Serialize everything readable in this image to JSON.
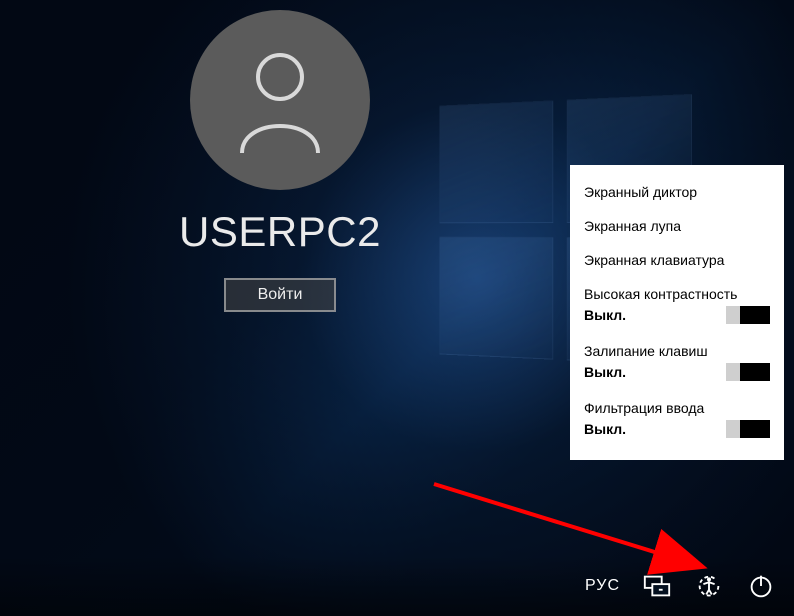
{
  "user": {
    "name": "UserPC2",
    "signin_label": "Войти"
  },
  "ease_of_access": {
    "items": [
      {
        "label": "Экранный диктор"
      },
      {
        "label": "Экранная лупа"
      },
      {
        "label": "Экранная клавиатура"
      }
    ],
    "toggles": [
      {
        "label": "Высокая контрастность",
        "state": "Выкл."
      },
      {
        "label": "Залипание клавиш",
        "state": "Выкл."
      },
      {
        "label": "Фильтрация ввода",
        "state": "Выкл."
      }
    ]
  },
  "bottombar": {
    "language": "РУС"
  }
}
